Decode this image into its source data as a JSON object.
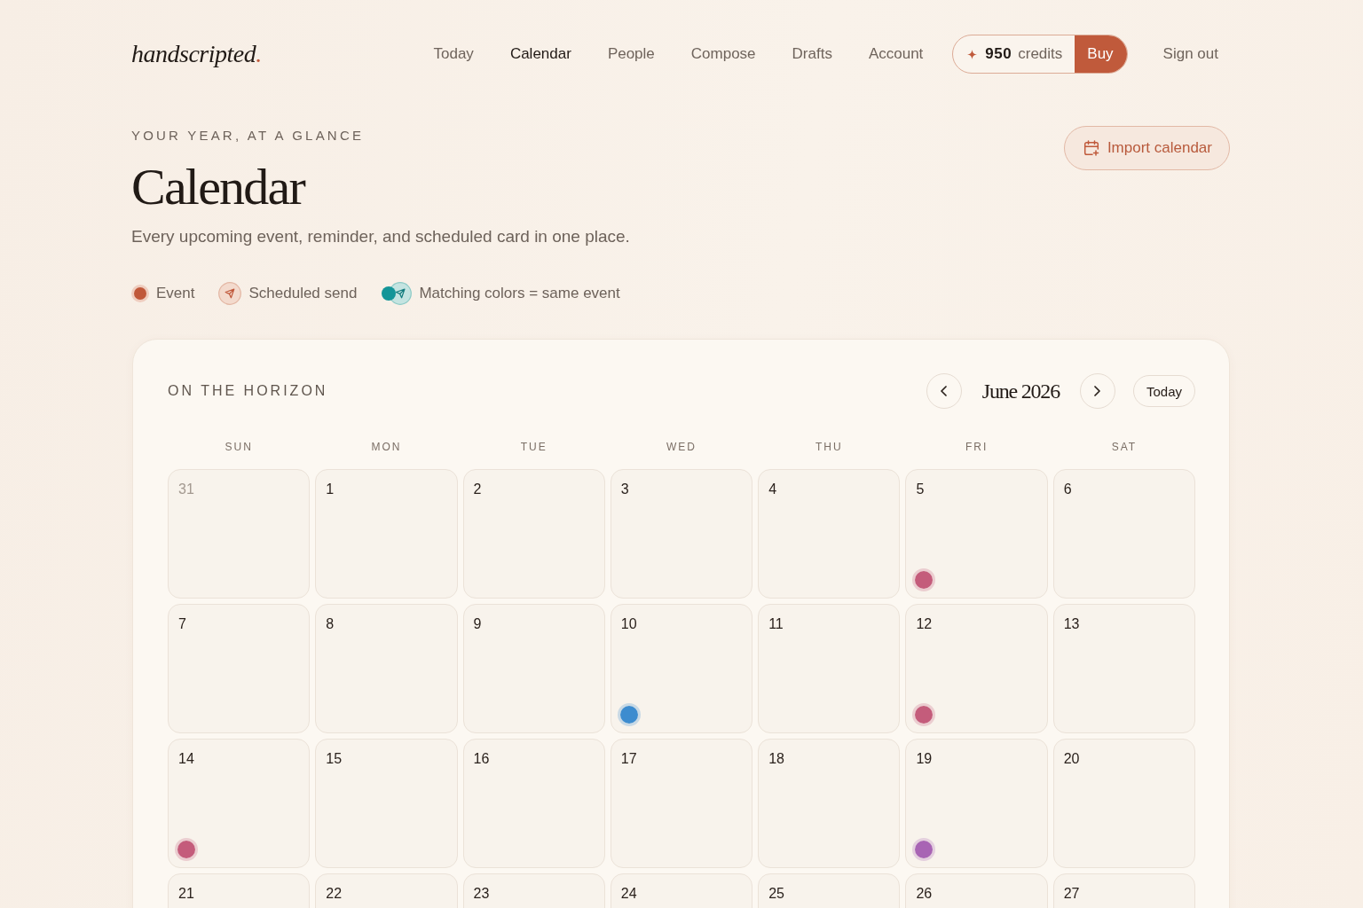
{
  "header": {
    "logo": {
      "text": "handscripted",
      "accent": "."
    },
    "nav": [
      {
        "label": "Today",
        "selected": false
      },
      {
        "label": "Calendar",
        "selected": true
      },
      {
        "label": "People",
        "selected": false
      },
      {
        "label": "Compose",
        "selected": false
      },
      {
        "label": "Drafts",
        "selected": false
      },
      {
        "label": "Account",
        "selected": false
      }
    ],
    "credits": {
      "amount": "950",
      "unit": "credits",
      "buy_label": "Buy"
    },
    "sign_out": "Sign out"
  },
  "hero": {
    "eyebrow": "YOUR YEAR, AT A GLANCE",
    "title": "Calendar",
    "subtitle": "Every upcoming event, reminder, and scheduled card in one place.",
    "import_button": "Import calendar"
  },
  "legend": [
    {
      "kind": "event",
      "label": "Event"
    },
    {
      "kind": "scheduled",
      "label": "Scheduled send"
    },
    {
      "kind": "matching",
      "label": "Matching colors = same event"
    }
  ],
  "calendar": {
    "eyebrow": "ON THE HORIZON",
    "month": "June 2026",
    "today_button": "Today",
    "weekdays": [
      "SUN",
      "MON",
      "TUE",
      "WED",
      "THU",
      "FRI",
      "SAT"
    ],
    "days": [
      {
        "date": "31",
        "outside_month": true
      },
      {
        "date": "1",
        "outside_month": false
      },
      {
        "date": "2",
        "outside_month": false
      },
      {
        "date": "3",
        "outside_month": false
      },
      {
        "date": "4",
        "outside_month": false
      },
      {
        "date": "5",
        "outside_month": false,
        "events": [
          {
            "color": "#c45c7b"
          }
        ]
      },
      {
        "date": "6",
        "outside_month": false
      },
      {
        "date": "7",
        "outside_month": false
      },
      {
        "date": "8",
        "outside_month": false
      },
      {
        "date": "9",
        "outside_month": false
      },
      {
        "date": "10",
        "outside_month": false,
        "events": [
          {
            "color": "#3d8ccf"
          }
        ]
      },
      {
        "date": "11",
        "outside_month": false
      },
      {
        "date": "12",
        "outside_month": false,
        "events": [
          {
            "color": "#c45c7b"
          }
        ]
      },
      {
        "date": "13",
        "outside_month": false
      },
      {
        "date": "14",
        "outside_month": false,
        "events": [
          {
            "color": "#c45c7b"
          }
        ]
      },
      {
        "date": "15",
        "outside_month": false
      },
      {
        "date": "16",
        "outside_month": false
      },
      {
        "date": "17",
        "outside_month": false
      },
      {
        "date": "18",
        "outside_month": false
      },
      {
        "date": "19",
        "outside_month": false,
        "events": [
          {
            "color": "#a864b4"
          }
        ]
      },
      {
        "date": "20",
        "outside_month": false
      },
      {
        "date": "21",
        "outside_month": false
      },
      {
        "date": "22",
        "outside_month": false
      },
      {
        "date": "23",
        "outside_month": false
      },
      {
        "date": "24",
        "outside_month": false
      },
      {
        "date": "25",
        "outside_month": false
      },
      {
        "date": "26",
        "outside_month": false
      },
      {
        "date": "27",
        "outside_month": false
      }
    ]
  }
}
